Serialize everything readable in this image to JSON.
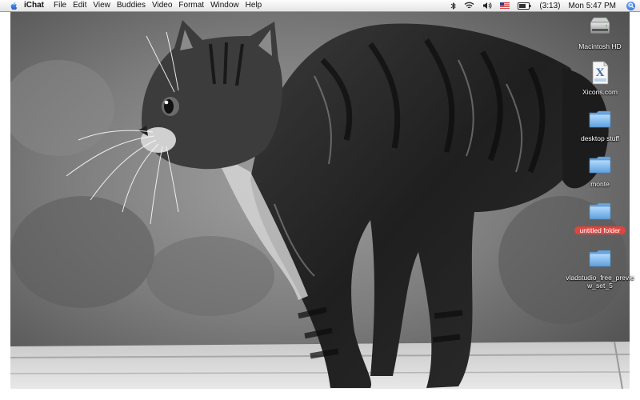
{
  "menubar": {
    "app_name": "iChat",
    "items": [
      "File",
      "Edit",
      "View",
      "Buddies",
      "Video",
      "Format",
      "Window",
      "Help"
    ],
    "battery_text": "(3:13)",
    "clock": "Mon 5:47 PM"
  },
  "desktop_icons": [
    {
      "label": "Macintosh HD",
      "icon": "hard-drive-icon"
    },
    {
      "label": "Xicons.com",
      "icon": "xicons-file-icon"
    },
    {
      "label": "desktop stuff",
      "icon": "folder-icon"
    },
    {
      "label": "monte",
      "icon": "folder-icon"
    },
    {
      "label": "untitled folder",
      "icon": "folder-icon",
      "selected": true
    },
    {
      "label": "vladstudio_free_preview_set_5",
      "icon": "folder-icon"
    }
  ],
  "colors": {
    "selection_label": "#e0443f",
    "folder_blue": "#8ec5f2",
    "spotlight_blue": "#1b5fd6"
  }
}
